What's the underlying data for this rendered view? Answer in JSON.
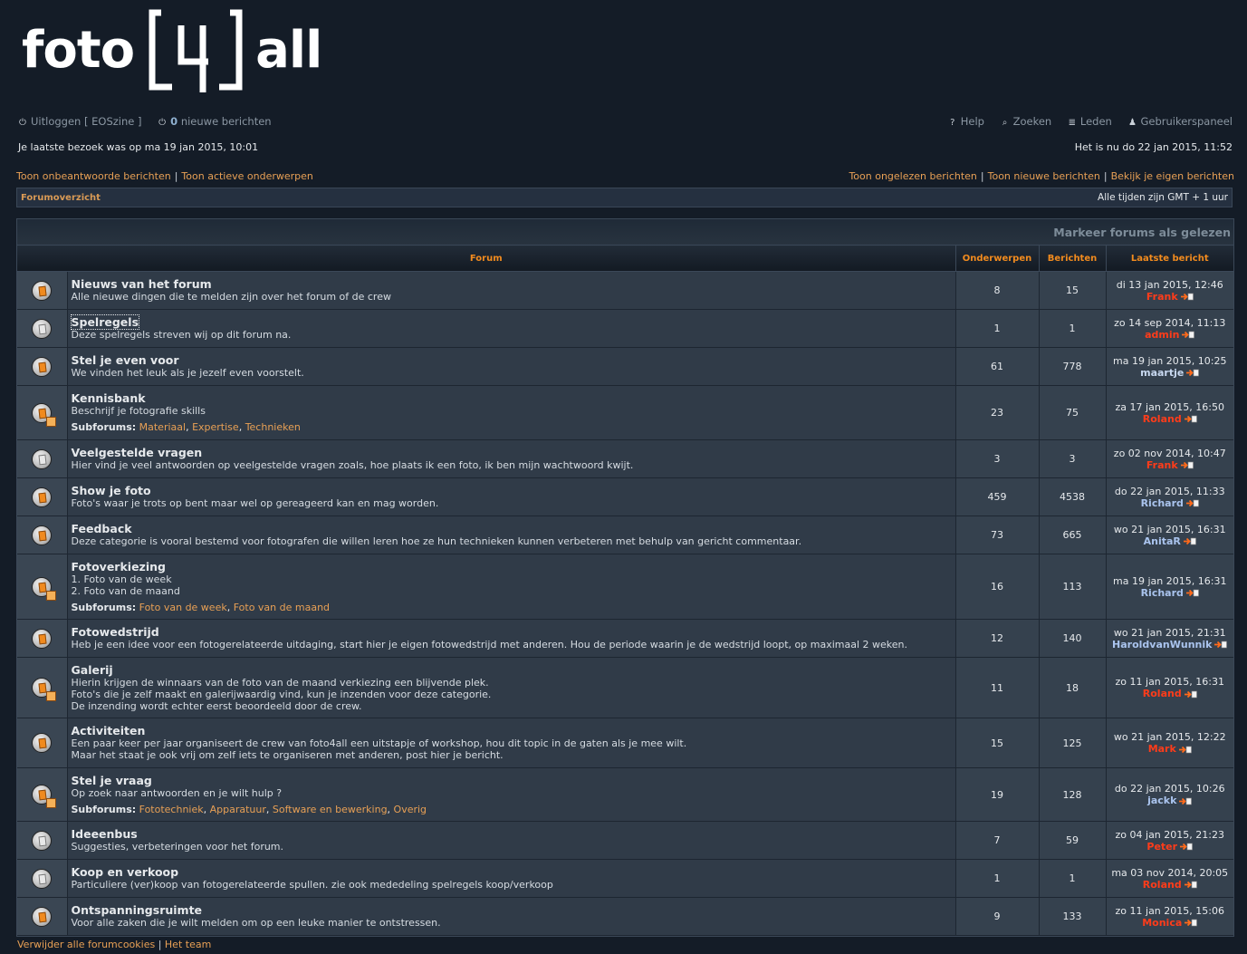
{
  "logo": {
    "left": "foto",
    "mark": "4",
    "right": "all"
  },
  "topnav": {
    "logout": "Uitloggen",
    "user": "[ EOSzine ]",
    "new_count": "0",
    "new_label": "nieuwe berichten",
    "help": "Help",
    "search": "Zoeken",
    "members": "Leden",
    "ucp": "Gebruikerspaneel"
  },
  "visit": {
    "last": "Je laatste bezoek was op ma 19 jan 2015, 10:01",
    "now": "Het is nu do 22 jan 2015, 11:52"
  },
  "searchlinks": {
    "unanswered": "Toon onbeantwoorde berichten",
    "active": "Toon actieve onderwerpen",
    "unread": "Toon ongelezen berichten",
    "new": "Toon nieuwe berichten",
    "own": "Bekijk je eigen berichten"
  },
  "breadcrumb": {
    "index": "Forumoverzicht",
    "timezone": "Alle tijden zijn GMT + 1 uur"
  },
  "mark_forums": "Markeer forums als gelezen",
  "headers": {
    "forum": "Forum",
    "topics": "Onderwerpen",
    "posts": "Berichten",
    "last": "Laatste bericht"
  },
  "subforums_label": "Subforums:",
  "forums": [
    {
      "title": "Nieuws van het forum",
      "desc": [
        "Alle nieuwe dingen die te melden zijn over het forum of de crew"
      ],
      "topics": "8",
      "posts": "15",
      "last_date": "di 13 jan 2015, 12:46",
      "last_author": "Frank",
      "author_color": "#ff3c1a"
    },
    {
      "title": "Spelregels",
      "desc": [
        "Deze spelregels streven wij op dit forum na."
      ],
      "topics": "1",
      "posts": "1",
      "last_date": "zo 14 sep 2014, 11:13",
      "last_author": "admin",
      "author_color": "#ff3c1a"
    },
    {
      "title": "Stel je even voor",
      "desc": [
        "We vinden het leuk als je jezelf even voorstelt."
      ],
      "topics": "61",
      "posts": "778",
      "last_date": "ma 19 jan 2015, 10:25",
      "last_author": "maartje",
      "author_color": "#c8d8f0"
    },
    {
      "title": "Kennisbank",
      "desc": [
        "Beschrijf je fotografie skills"
      ],
      "subforums": [
        "Materiaal",
        "Expertise",
        "Technieken"
      ],
      "topics": "23",
      "posts": "75",
      "last_date": "za 17 jan 2015, 16:50",
      "last_author": "Roland",
      "author_color": "#ff3c1a"
    },
    {
      "title": "Veelgestelde vragen",
      "desc": [
        "Hier vind je veel antwoorden op veelgestelde vragen zoals, hoe plaats ik een foto, ik ben mijn wachtwoord kwijt."
      ],
      "topics": "3",
      "posts": "3",
      "last_date": "zo 02 nov 2014, 10:47",
      "last_author": "Frank",
      "author_color": "#ff3c1a"
    },
    {
      "title": "Show je foto",
      "desc": [
        "Foto's waar je trots op bent maar wel op gereageerd kan en mag worden."
      ],
      "topics": "459",
      "posts": "4538",
      "last_date": "do 22 jan 2015, 11:33",
      "last_author": "Richard",
      "author_color": "#aac4ee"
    },
    {
      "title": "Feedback",
      "desc": [
        "Deze categorie is vooral bestemd voor fotografen die willen leren hoe ze hun technieken kunnen verbeteren met behulp van gericht commentaar."
      ],
      "topics": "73",
      "posts": "665",
      "last_date": "wo 21 jan 2015, 16:31",
      "last_author": "AnitaR",
      "author_color": "#aac4ee"
    },
    {
      "title": "Fotoverkiezing",
      "desc": [
        "1. Foto van de week",
        "2. Foto van de maand"
      ],
      "subforums": [
        "Foto van de week",
        "Foto van de maand"
      ],
      "topics": "16",
      "posts": "113",
      "last_date": "ma 19 jan 2015, 16:31",
      "last_author": "Richard",
      "author_color": "#aac4ee"
    },
    {
      "title": "Fotowedstrijd",
      "desc": [
        "Heb je een idee voor een fotogerelateerde uitdaging, start hier je eigen fotowedstrijd met anderen. Hou de periode waarin je de wedstrijd loopt, op maximaal 2 weken."
      ],
      "topics": "12",
      "posts": "140",
      "last_date": "wo 21 jan 2015, 21:31",
      "last_author": "HaroldvanWunnik",
      "author_color": "#aac4ee"
    },
    {
      "title": "Galerij",
      "desc": [
        "Hierin krijgen de winnaars van de foto van de maand verkiezing een blijvende plek.",
        "Foto's die je zelf maakt en galerijwaardig vind, kun je inzenden voor deze categorie.",
        "De inzending wordt echter eerst beoordeeld door de crew."
      ],
      "topics": "11",
      "posts": "18",
      "last_date": "zo 11 jan 2015, 16:31",
      "last_author": "Roland",
      "author_color": "#ff3c1a"
    },
    {
      "title": "Activiteiten",
      "desc": [
        "Een paar keer per jaar organiseert de crew van foto4all een uitstapje of workshop, hou dit topic in de gaten als je mee wilt.",
        "Maar het staat je ook vrij om zelf iets te organiseren met anderen, post hier je bericht."
      ],
      "topics": "15",
      "posts": "125",
      "last_date": "wo 21 jan 2015, 12:22",
      "last_author": "Mark",
      "author_color": "#ff3c1a"
    },
    {
      "title": "Stel je vraag",
      "desc": [
        "Op zoek naar antwoorden en je wilt hulp ?"
      ],
      "subforums": [
        "Fototechniek",
        "Apparatuur",
        "Software en bewerking",
        "Overig"
      ],
      "topics": "19",
      "posts": "128",
      "last_date": "do 22 jan 2015, 10:26",
      "last_author": "jackk",
      "author_color": "#aac4ee"
    },
    {
      "title": "Ideeenbus",
      "desc": [
        "Suggesties, verbeteringen voor het forum."
      ],
      "topics": "7",
      "posts": "59",
      "last_date": "zo 04 jan 2015, 21:23",
      "last_author": "Peter",
      "author_color": "#ff3c1a"
    },
    {
      "title": "Koop en verkoop",
      "desc": [
        "Particuliere (ver)koop van fotogerelateerde spullen. zie ook mededeling spelregels koop/verkoop"
      ],
      "topics": "1",
      "posts": "1",
      "last_date": "ma 03 nov 2014, 20:05",
      "last_author": "Roland",
      "author_color": "#ff3c1a"
    },
    {
      "title": "Ontspanningsruimte",
      "desc": [
        "Voor alle zaken die je wilt melden om op een leuke manier te ontstressen."
      ],
      "topics": "9",
      "posts": "133",
      "last_date": "zo 11 jan 2015, 15:06",
      "last_author": "Monica",
      "author_color": "#ff3c1a"
    }
  ],
  "icon_variants": [
    "orange",
    "white",
    "orange",
    "sub",
    "white",
    "orange",
    "orange",
    "sub",
    "orange",
    "sub",
    "orange",
    "sub",
    "white",
    "white",
    "orange"
  ],
  "footer": {
    "cookies": "Verwijder alle forumcookies",
    "team": "Het team"
  }
}
